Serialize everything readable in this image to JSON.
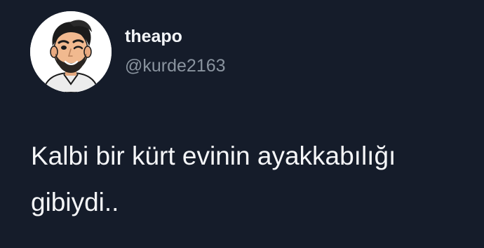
{
  "tweet": {
    "author": {
      "display_name": "theapo",
      "handle": "@kurde2163",
      "avatar_icon": "cartoon-avatar-icon"
    },
    "text_lines": [
      "Kalbi bir kürt evinin ayakkabılığı",
      "gibiydi.."
    ]
  },
  "colors": {
    "background": "#151c2a",
    "display_name": "#f3f5f8",
    "handle": "#8a949f",
    "body_text": "#f5f6f8"
  }
}
